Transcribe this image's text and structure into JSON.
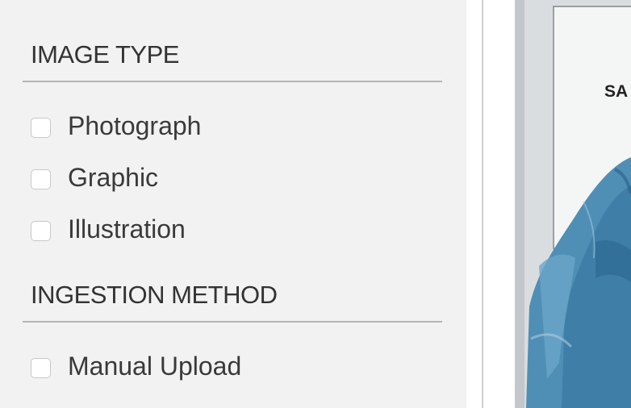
{
  "filters": {
    "image_type": {
      "title": "IMAGE TYPE",
      "options": [
        {
          "label": "Photograph",
          "checked": false
        },
        {
          "label": "Graphic",
          "checked": false
        },
        {
          "label": "Illustration",
          "checked": false
        }
      ]
    },
    "ingestion_method": {
      "title": "INGESTION METHOD",
      "options": [
        {
          "label": "Manual Upload",
          "checked": false
        }
      ]
    }
  },
  "preview": {
    "sign_text": "SA"
  }
}
